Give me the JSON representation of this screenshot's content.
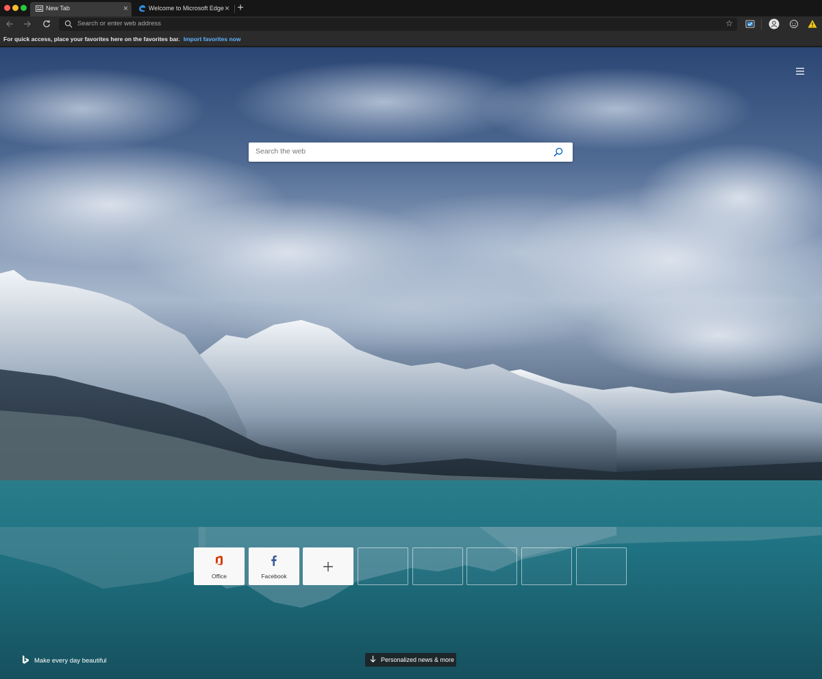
{
  "browser": {
    "tabs": [
      {
        "title": "New Tab",
        "active": true
      },
      {
        "title": "Welcome to Microsoft Edge Ca",
        "active": false
      }
    ],
    "address_placeholder": "Search or enter web address",
    "favorites_bar": {
      "message": "For quick access, place your favorites here on the favorites bar.",
      "link": "Import favorites now"
    },
    "icons": {
      "back": "back-arrow-icon",
      "forward": "forward-arrow-icon",
      "refresh": "refresh-icon",
      "favorite": "star-icon",
      "collections": "collections-icon",
      "profile": "profile-icon",
      "feedback": "smiley-icon",
      "warning": "warning-icon"
    },
    "colors": {
      "accent_link": "#5fb3ff",
      "warning": "#f2c811",
      "office_brand": "#d83b01",
      "facebook_brand": "#3b5998"
    }
  },
  "newtab": {
    "search_placeholder": "Search the web",
    "quick_links": [
      {
        "label": "Office",
        "icon": "office-icon"
      },
      {
        "label": "Facebook",
        "icon": "facebook-icon"
      },
      {
        "label": "",
        "icon": "plus-icon"
      }
    ],
    "empty_tiles": 5,
    "footer": {
      "tagline": "Make every day beautiful",
      "news_button": "Personalized news & more"
    }
  }
}
